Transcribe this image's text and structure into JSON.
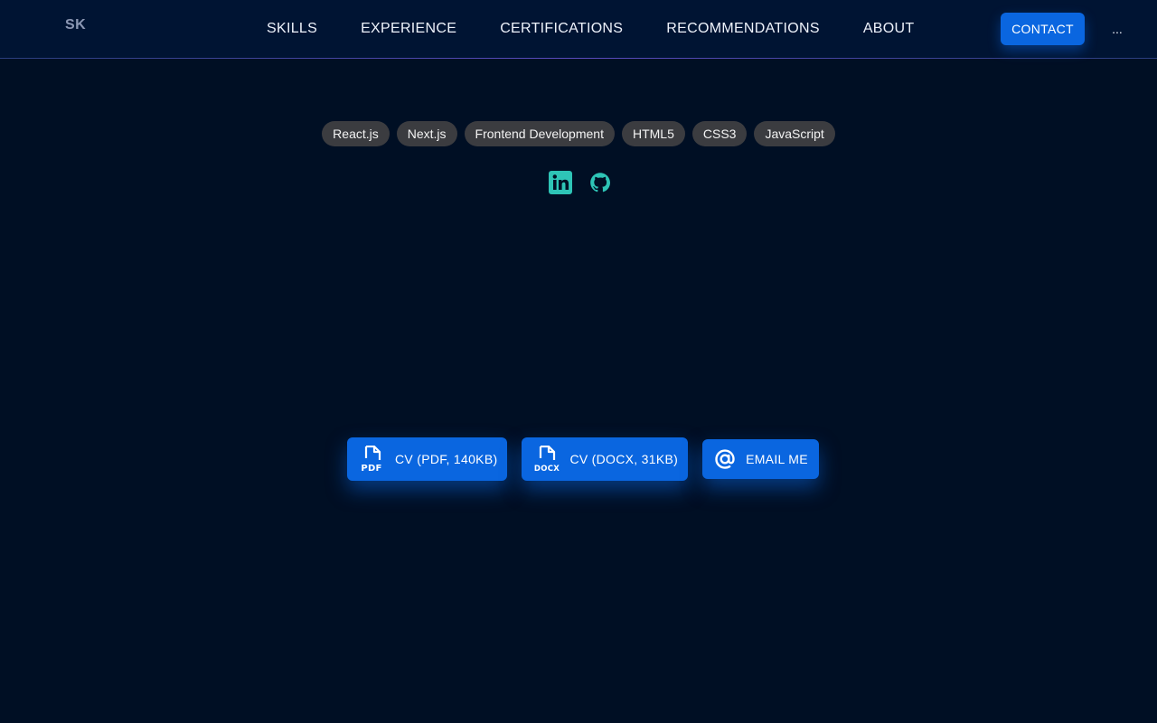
{
  "header": {
    "logo": "SK",
    "nav": [
      "SKILLS",
      "EXPERIENCE",
      "CERTIFICATIONS",
      "RECOMMENDATIONS",
      "ABOUT"
    ],
    "contact_label": "CONTACT",
    "more_label": "..."
  },
  "tags": [
    "React.js",
    "Next.js",
    "Frontend Development",
    "HTML5",
    "CSS3",
    "JavaScript"
  ],
  "socials": [
    {
      "icon": "linkedin-icon"
    },
    {
      "icon": "github-icon"
    }
  ],
  "actions": {
    "cv_pdf": {
      "label": "CV (PDF, 140KB)",
      "icon_text": "PDF"
    },
    "cv_docx": {
      "label": "CV (DOCX, 31KB)",
      "icon_text": "DOCX"
    },
    "email": {
      "label": "EMAIL ME"
    }
  },
  "colors": {
    "background": "#000f24",
    "header": "#001433",
    "accent": "#0a66e0",
    "social": "#2ec4b6",
    "tag": "#3b3c40"
  }
}
